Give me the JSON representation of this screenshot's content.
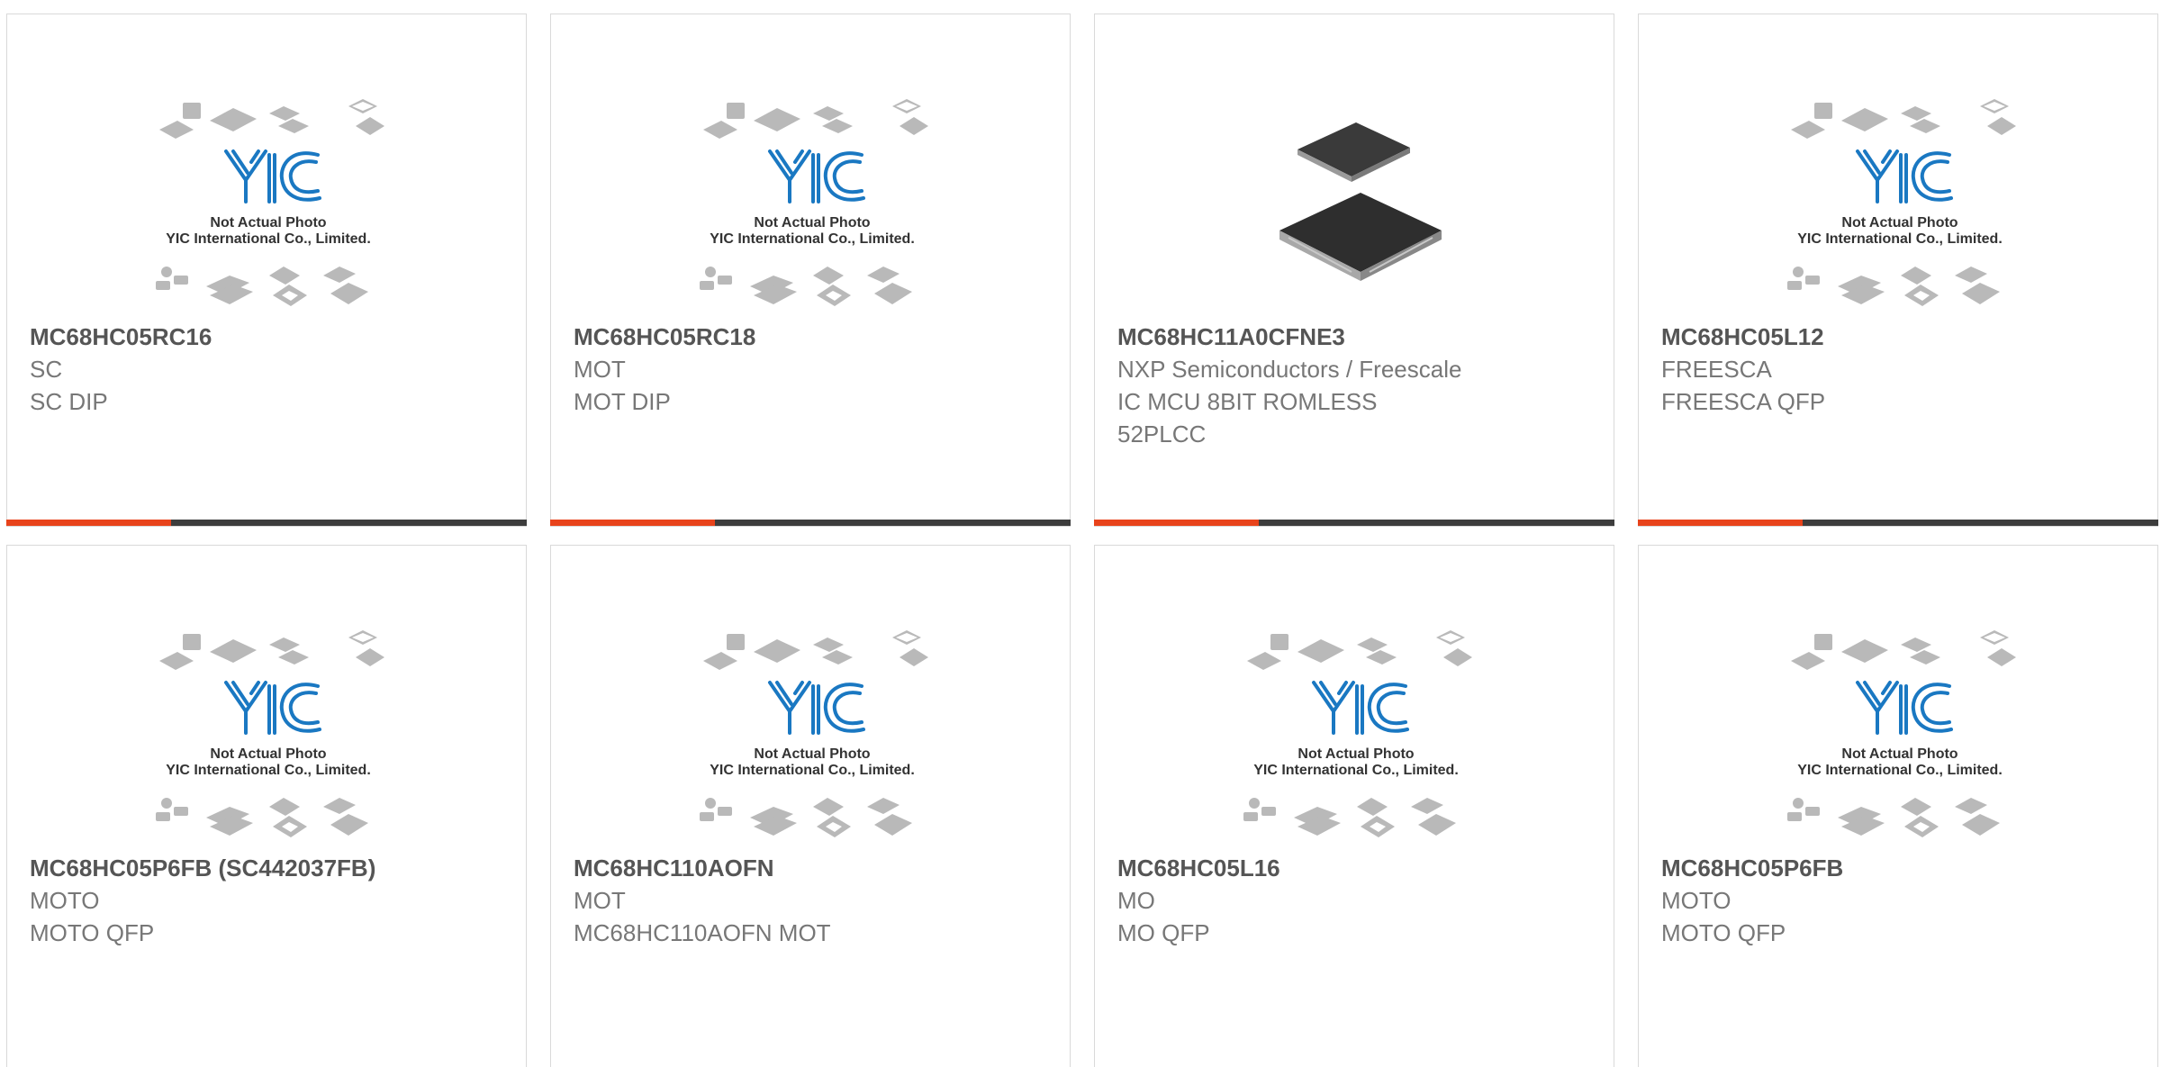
{
  "placeholder": {
    "line1": "Not Actual Photo",
    "line2": "YIC International Co., Limited."
  },
  "colors": {
    "accent": "#e8431b",
    "bar": "#3d3d3d",
    "logo_blue": "#1a78c2",
    "title": "#555555",
    "text": "#777777"
  },
  "products": [
    {
      "part": "MC68HC05RC16",
      "maker": "SC",
      "desc": "SC DIP",
      "desc2": "",
      "image": "placeholder"
    },
    {
      "part": "MC68HC05RC18",
      "maker": "MOT",
      "desc": "MOT DIP",
      "desc2": "",
      "image": "placeholder"
    },
    {
      "part": "MC68HC11A0CFNE3",
      "maker": "NXP Semiconductors / Freescale",
      "desc": "IC MCU 8BIT ROMLESS",
      "desc2": "52PLCC",
      "image": "chip-photo"
    },
    {
      "part": "MC68HC05L12",
      "maker": "FREESCA",
      "desc": "FREESCA QFP",
      "desc2": "",
      "image": "placeholder"
    },
    {
      "part": "MC68HC05P6FB (SC442037FB)",
      "maker": "MOTO",
      "desc": "MOTO QFP",
      "desc2": "",
      "image": "placeholder"
    },
    {
      "part": "MC68HC110AOFN",
      "maker": "MOT",
      "desc": "MC68HC110AOFN MOT",
      "desc2": "",
      "image": "placeholder"
    },
    {
      "part": "MC68HC05L16",
      "maker": "MO",
      "desc": "MO QFP",
      "desc2": "",
      "image": "placeholder"
    },
    {
      "part": "MC68HC05P6FB",
      "maker": "MOTO",
      "desc": "MOTO QFP",
      "desc2": "",
      "image": "placeholder"
    }
  ]
}
